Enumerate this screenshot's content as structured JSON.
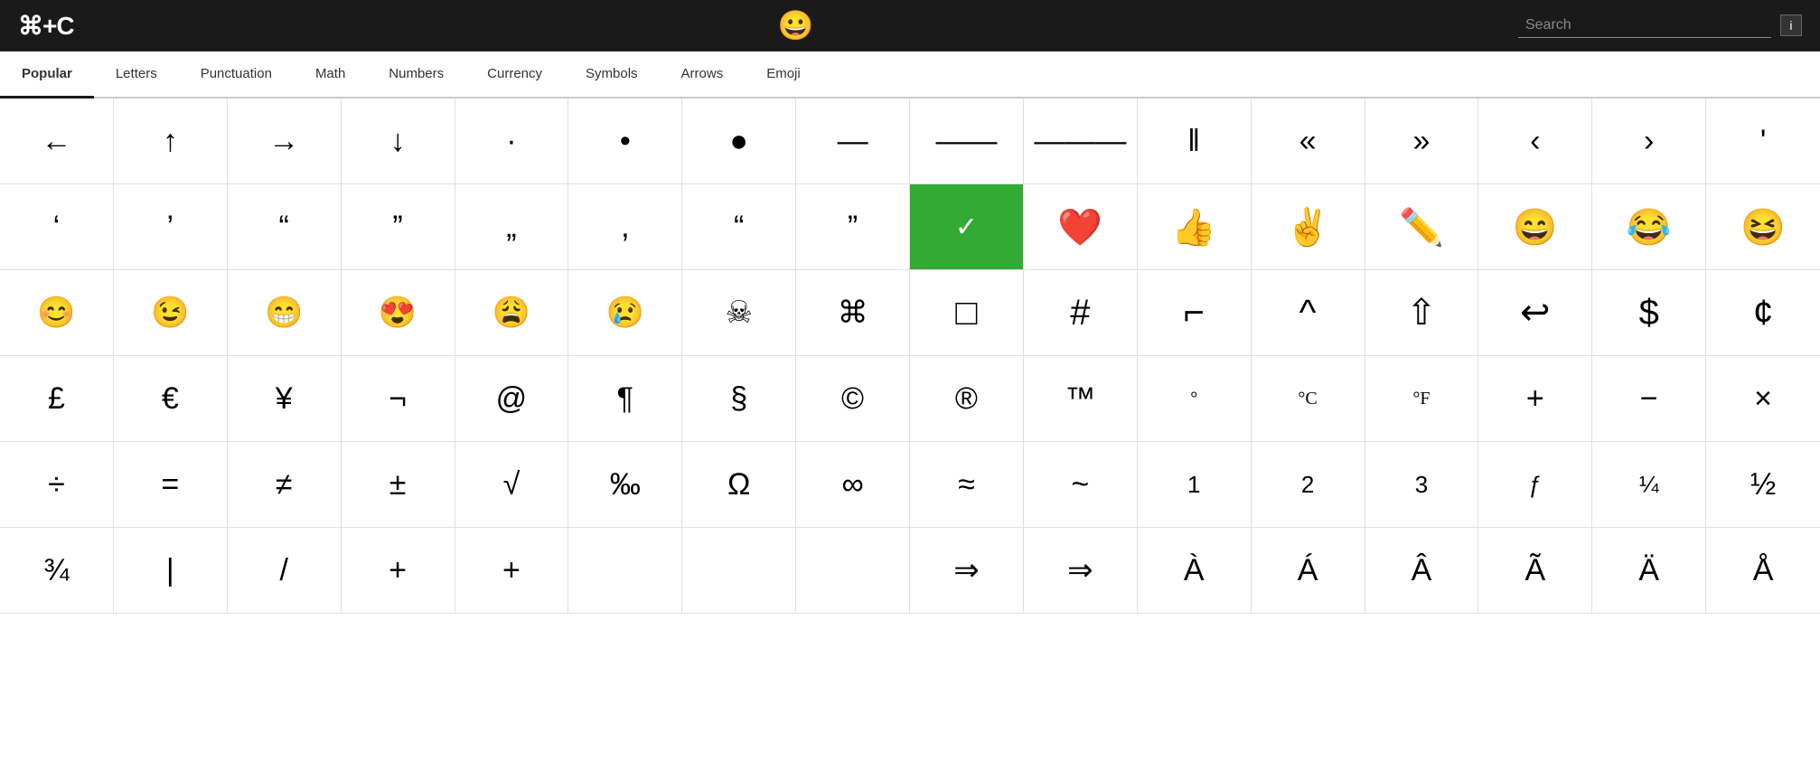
{
  "header": {
    "logo": "⌘+C",
    "center_emoji": "😀",
    "search_placeholder": "Search",
    "info_label": "i"
  },
  "nav": {
    "items": [
      {
        "label": "Popular",
        "active": true
      },
      {
        "label": "Letters",
        "active": false
      },
      {
        "label": "Punctuation",
        "active": false
      },
      {
        "label": "Math",
        "active": false
      },
      {
        "label": "Numbers",
        "active": false
      },
      {
        "label": "Currency",
        "active": false
      },
      {
        "label": "Symbols",
        "active": false
      },
      {
        "label": "Arrows",
        "active": false
      },
      {
        "label": "Emoji",
        "active": false
      }
    ]
  },
  "grid": {
    "rows": [
      [
        "←",
        "↑",
        "→",
        "↓",
        "·",
        "•",
        "●",
        "—",
        "——",
        "———",
        "‖",
        "«",
        "»",
        "‹",
        "›",
        "'"
      ],
      [
        "'",
        ",",
        "\"",
        "\"",
        "„",
        ",",
        "❝",
        "❞",
        "☑",
        "❤️",
        "👍",
        "✌️",
        "✏️",
        "😄",
        "😂",
        "😆"
      ],
      [
        "😊",
        "😉",
        "😁",
        "😍",
        "😩",
        "😢",
        "☠",
        "⌘",
        "□",
        "#",
        "⌐",
        "^",
        "⇧",
        "↩",
        "$",
        "¢"
      ],
      [
        "£",
        "€",
        "¥",
        "¬",
        "@",
        "¶",
        "§",
        "©",
        "®",
        "™",
        "°",
        "°C",
        "°F",
        "+",
        "−",
        "×"
      ],
      [
        "÷",
        "=",
        "≠",
        "±",
        "√",
        "‰",
        "Ω",
        "∞",
        "≈",
        "~",
        "1",
        "2",
        "3",
        "ƒ",
        "¼",
        "½"
      ],
      [
        "¾",
        "|",
        "/",
        "+",
        "+",
        "",
        "",
        "",
        "⇒",
        "⇒⇒",
        "À",
        "Á",
        "Â",
        "Ã",
        "Ä",
        "Å"
      ]
    ]
  }
}
